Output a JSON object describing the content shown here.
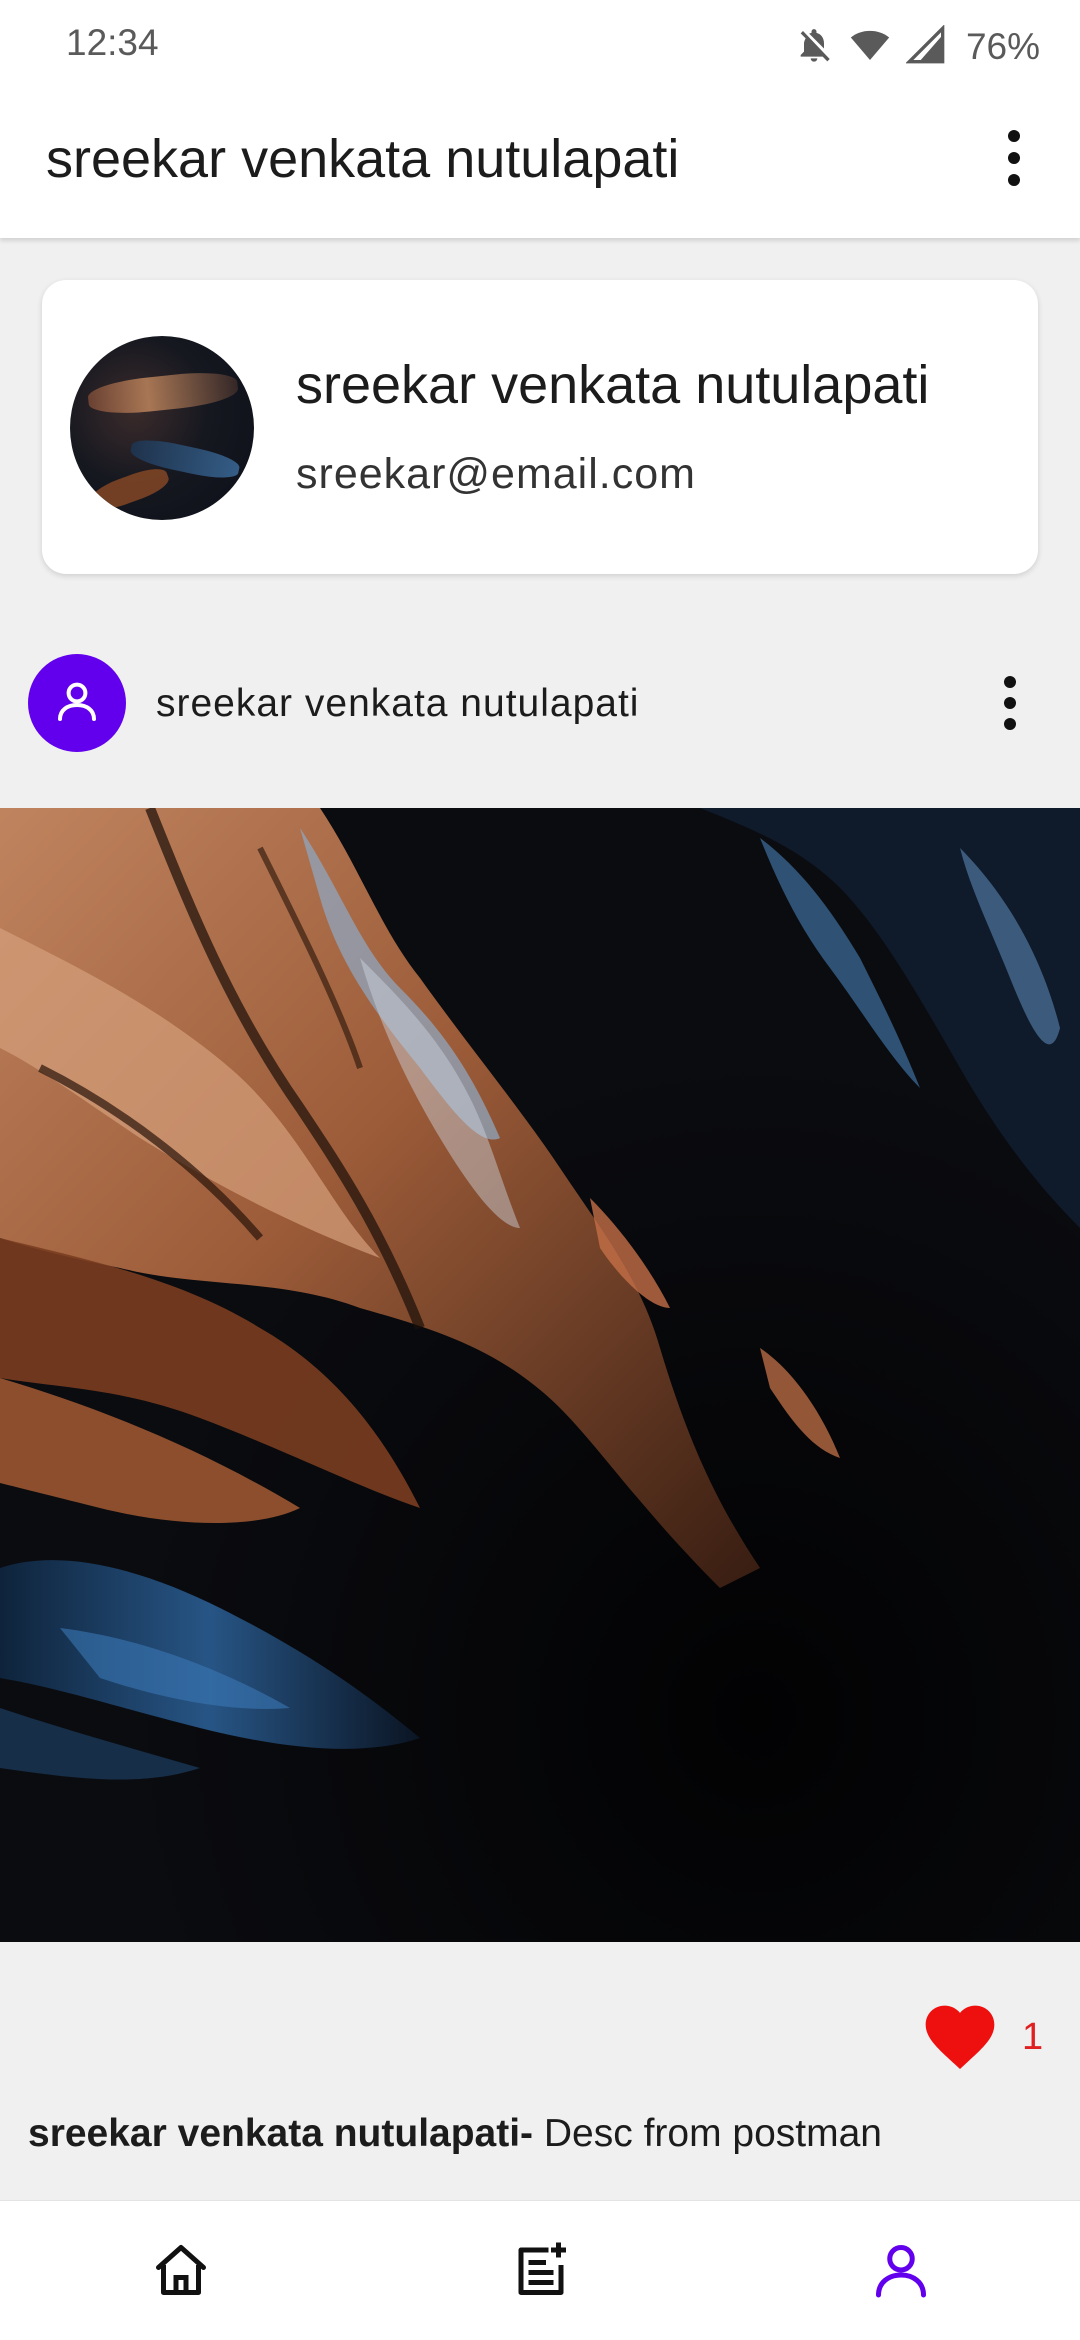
{
  "status_bar": {
    "time": "12:34",
    "battery": "76%",
    "icons": [
      "notifications-off-icon",
      "wifi-icon",
      "cellular-signal-icon"
    ]
  },
  "app_bar": {
    "title": "sreekar venkata nutulapati",
    "menu_icon": "more-vert-icon"
  },
  "profile": {
    "name": "sreekar venkata nutulapati",
    "email": "sreekar@email.com"
  },
  "post": {
    "author": "sreekar venkata nutulapati",
    "avatar_icon": "person-icon",
    "menu_icon": "more-vert-icon",
    "likes": "1",
    "caption_author": "sreekar venkata nutulapati-",
    "caption_text": " Desc from postman"
  },
  "bottom_nav": {
    "items": [
      {
        "icon": "home-icon",
        "active": false
      },
      {
        "icon": "add-post-icon",
        "active": false
      },
      {
        "icon": "profile-icon",
        "active": true
      }
    ]
  },
  "colors": {
    "accent": "#6200ee",
    "like": "#e02020",
    "background": "#f0f0f0"
  }
}
